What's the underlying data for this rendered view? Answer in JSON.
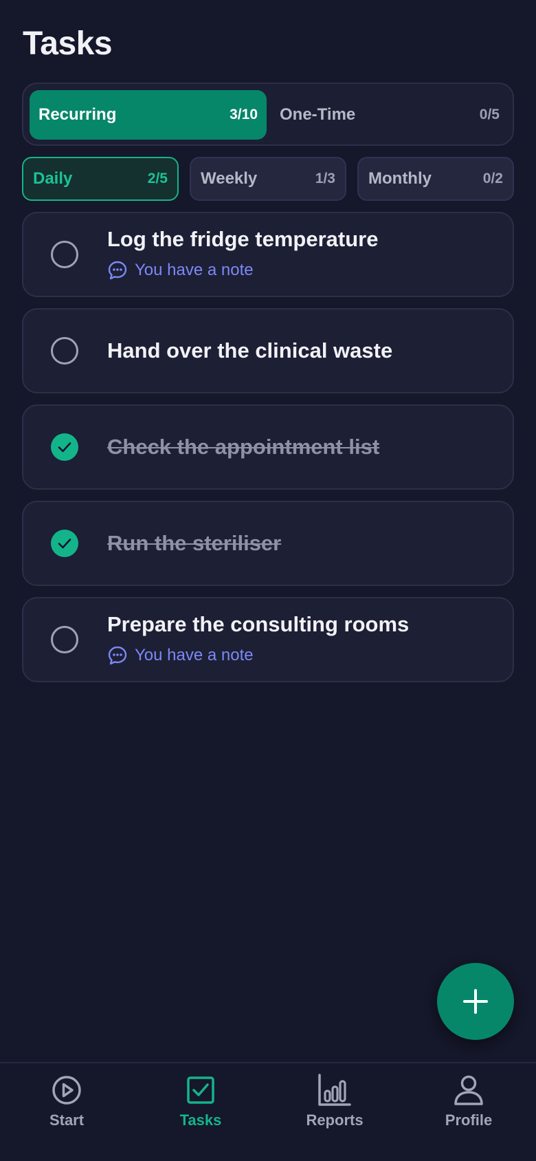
{
  "header": {
    "title": "Tasks"
  },
  "segments": [
    {
      "label": "Recurring",
      "count": "3/10",
      "selected": true
    },
    {
      "label": "One-Time",
      "count": "0/5",
      "selected": false
    }
  ],
  "filters": [
    {
      "label": "Daily",
      "count": "2/5",
      "selected": true
    },
    {
      "label": "Weekly",
      "count": "1/3",
      "selected": false
    },
    {
      "label": "Monthly",
      "count": "0/2",
      "selected": false
    }
  ],
  "tasks": [
    {
      "title": "Log the fridge temperature",
      "done": false,
      "note": "You have a note"
    },
    {
      "title": "Hand over the clinical waste",
      "done": false,
      "note": null
    },
    {
      "title": "Check the appointment list",
      "done": true,
      "note": null
    },
    {
      "title": "Run the steriliser",
      "done": true,
      "note": null
    },
    {
      "title": "Prepare the consulting rooms",
      "done": false,
      "note": "You have a note"
    }
  ],
  "fab": {
    "icon": "plus-icon"
  },
  "nav": [
    {
      "label": "Start",
      "icon": "play-circle-icon",
      "active": false
    },
    {
      "label": "Tasks",
      "icon": "checkbox-icon",
      "active": true
    },
    {
      "label": "Reports",
      "icon": "bar-chart-icon",
      "active": false
    },
    {
      "label": "Profile",
      "icon": "user-icon",
      "active": false
    }
  ],
  "colors": {
    "background": "#15172a",
    "accent": "#06876a",
    "accent_bright": "#14b48a",
    "note": "#7b89f5",
    "card": "#1d1f35"
  }
}
